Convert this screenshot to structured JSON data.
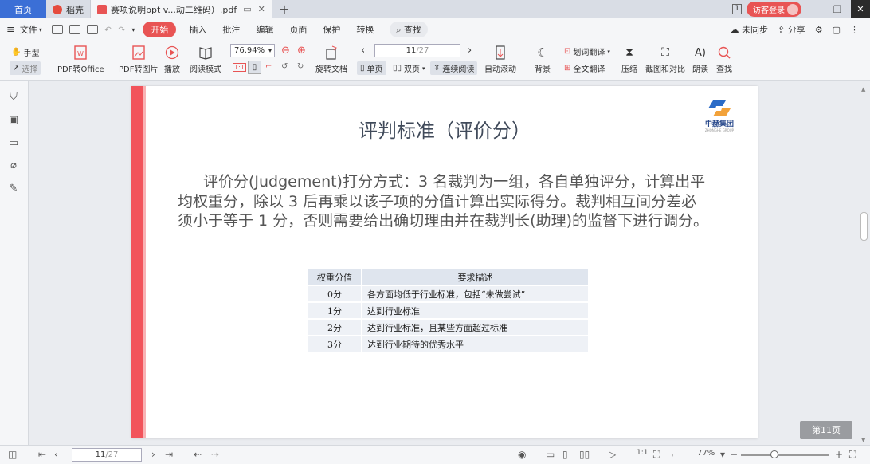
{
  "tabs": {
    "home": "首页",
    "wps": "稻壳",
    "doc": "赛项说明ppt v...动二维码）.pdf",
    "new": "+"
  },
  "titlebar": {
    "page_badge": "1",
    "visitor_login": "访客登录"
  },
  "menu": {
    "file": "文件",
    "items": [
      "开始",
      "插入",
      "批注",
      "编辑",
      "页面",
      "保护",
      "转换"
    ],
    "search": "查找",
    "not_synced": "未同步",
    "share": "分享"
  },
  "ribbon": {
    "hand": "手型",
    "select": "选择",
    "pdf_to_office": "PDF转Office",
    "pdf_to_image": "PDF转图片",
    "play": "播放",
    "read_mode": "阅读模式",
    "zoom": "76.94%",
    "rotate": "旋转文档",
    "page_current": "11",
    "page_total": "/27",
    "single": "单页",
    "double": "双页",
    "continuous": "连续阅读",
    "auto_scroll": "自动滚动",
    "background": "背景",
    "word_translate": "划词翻译",
    "full_translate": "全文翻译",
    "compress": "压缩",
    "screenshot_compare": "截图和对比",
    "read_aloud": "朗读",
    "find": "查找"
  },
  "slide": {
    "title": "评判标准（评价分）",
    "logo_name": "中赫集团",
    "logo_sub": "ZHONGHE GROUP",
    "paragraph": "评价分(Judgement)打分方式：3 名裁判为一组，各自单独评分，计算出平均权重分，除以 3 后再乘以该子项的分值计算出实际得分。裁判相互间分差必须小于等于 1 分，否则需要给出确切理由并在裁判长(助理)的监督下进行调分。",
    "table": {
      "headers": [
        "权重分值",
        "要求描述"
      ],
      "rows": [
        [
          "0分",
          "各方面均低于行业标准，包括“未做尝试”"
        ],
        [
          "1分",
          "达到行业标准"
        ],
        [
          "2分",
          "达到行业标准，且某些方面超过标准"
        ],
        [
          "3分",
          "达到行业期待的优秀水平"
        ]
      ]
    },
    "page_tag": "第11页"
  },
  "status": {
    "page_current": "11",
    "page_total": "/27",
    "zoom": "77%"
  },
  "colors": {
    "accent": "#e85454",
    "slide_red": "#f2535b",
    "tab_blue": "#3b6fd6"
  }
}
